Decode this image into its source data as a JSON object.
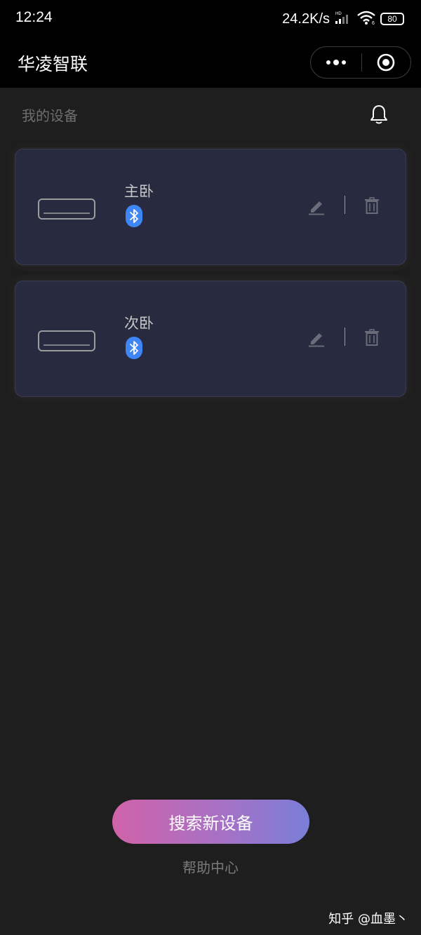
{
  "status_bar": {
    "time": "12:24",
    "network_speed": "24.2K/s",
    "battery": "80"
  },
  "nav": {
    "title": "华凌智联"
  },
  "section": {
    "title": "我的设备"
  },
  "devices": [
    {
      "name": "主卧",
      "icon": "air-conditioner-icon",
      "connection": "bluetooth-icon"
    },
    {
      "name": "次卧",
      "icon": "air-conditioner-icon",
      "connection": "bluetooth-icon"
    }
  ],
  "actions": {
    "search_label": "搜索新设备",
    "help_label": "帮助中心"
  },
  "watermark": {
    "text": "知乎 @血墨丶"
  },
  "colors": {
    "background": "#1e1e1e",
    "card": "#282a40",
    "bluetooth": "#3f86f5",
    "button_gradient_start": "#d063a9",
    "button_gradient_end": "#7a7ed8"
  }
}
